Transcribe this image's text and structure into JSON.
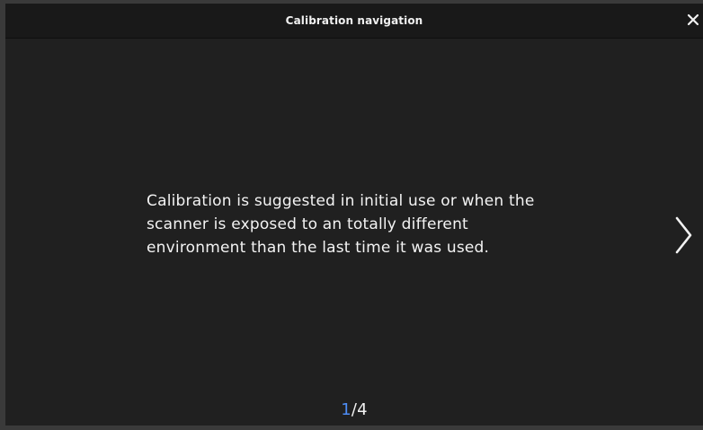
{
  "dialog": {
    "title": "Calibration navigation",
    "message_lines": [
      "Calibration is suggested in initial use or when the",
      "scanner is exposed to an totally different",
      "environment than the last time it was used."
    ],
    "pager": {
      "current": "1",
      "separator": "/",
      "total": "4"
    }
  },
  "icons": {
    "close": "close-icon",
    "next": "chevron-right-icon"
  },
  "colors": {
    "background": "#202020",
    "titlebar": "#191919",
    "text": "#f0f0f0",
    "accent": "#4e8df5"
  }
}
